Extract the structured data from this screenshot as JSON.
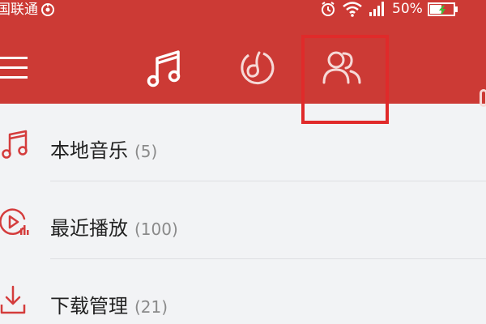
{
  "status_bar": {
    "carrier": "国联通",
    "battery_percent": "50%",
    "icons": [
      "hotspot-icon",
      "alarm-icon",
      "wifi-icon",
      "signal-icon",
      "battery-icon"
    ]
  },
  "nav": {
    "tabs": [
      {
        "icon": "music-note-icon",
        "selected": false
      },
      {
        "icon": "discover-icon",
        "selected": false
      },
      {
        "icon": "friends-icon",
        "selected": true
      }
    ],
    "highlight_color": "#e02a2a"
  },
  "list": {
    "items": [
      {
        "title": "本地音乐",
        "count": "(5)",
        "icon": "music-file-icon"
      },
      {
        "title": "最近播放",
        "count": "(100)",
        "icon": "recent-play-icon"
      },
      {
        "title": "下载管理",
        "count": "(21)",
        "icon": "download-icon"
      }
    ]
  },
  "colors": {
    "brand_red": "#cc3a35",
    "list_background": "#f2f3f5",
    "icon_red": "#d43c3c",
    "count_gray": "#8a8a8a"
  }
}
